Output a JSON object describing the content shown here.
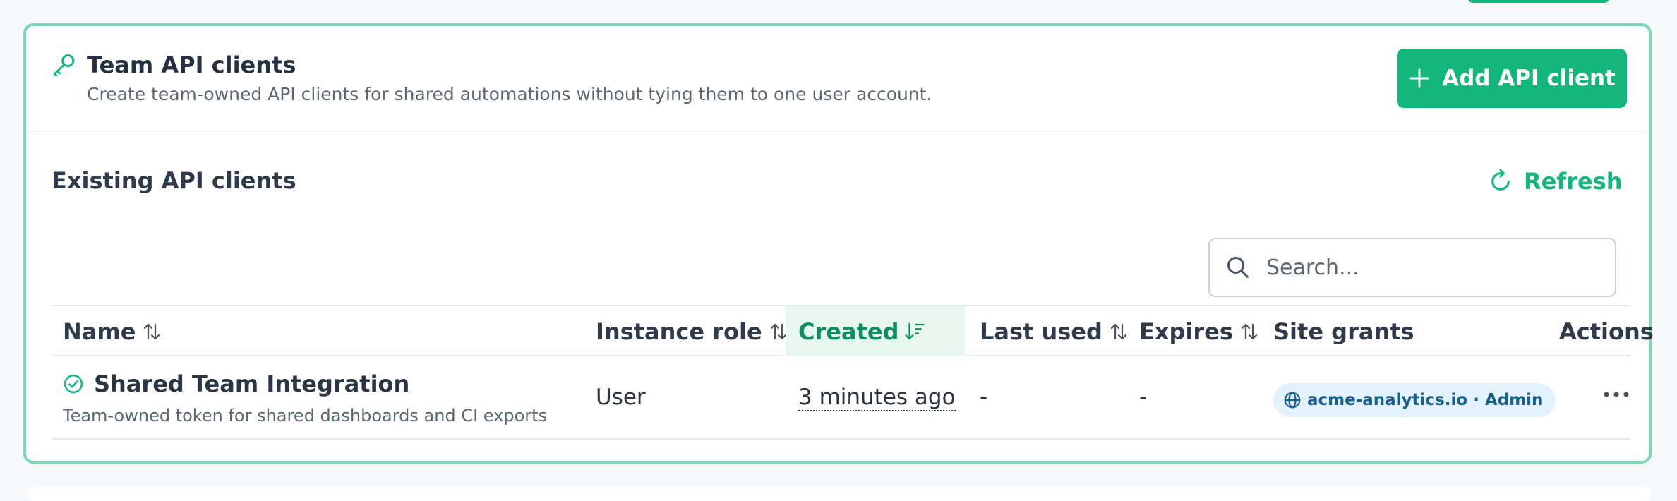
{
  "header": {
    "title": "Team API clients",
    "subtitle": "Create team-owned API clients for shared automations without tying them to one user account.",
    "add_button_label": "Add API client"
  },
  "section": {
    "title": "Existing API clients",
    "refresh_label": "Refresh"
  },
  "search": {
    "placeholder": "Search...",
    "value": ""
  },
  "table": {
    "columns": {
      "name": "Name",
      "instance_role": "Instance role",
      "created": "Created",
      "last_used": "Last used",
      "expires": "Expires",
      "site_grants": "Site grants",
      "actions": "Actions"
    },
    "sorted_column": "created",
    "rows": [
      {
        "name": "Shared Team Integration",
        "description": "Team-owned token for shared dashboards and CI exports",
        "instance_role": "User",
        "created": "3 minutes ago",
        "last_used": "-",
        "expires": "-",
        "site_grant": "acme-analytics.io · Admin"
      }
    ]
  },
  "colors": {
    "accent": "#13b67b",
    "card_border": "#7cd9b6",
    "sorted_header_bg": "#e8f8f1",
    "badge_bg": "#e3f2fd",
    "badge_text": "#16618f"
  },
  "icons": {
    "header": "key-icon",
    "add": "plus-icon",
    "refresh": "refresh-icon",
    "search": "search-icon",
    "sort": "sort-arrows-icon",
    "sort_active": "sort-descending-icon",
    "row_status": "check-circle-icon",
    "grant": "globe-icon",
    "actions": "more-horizontal-icon"
  }
}
